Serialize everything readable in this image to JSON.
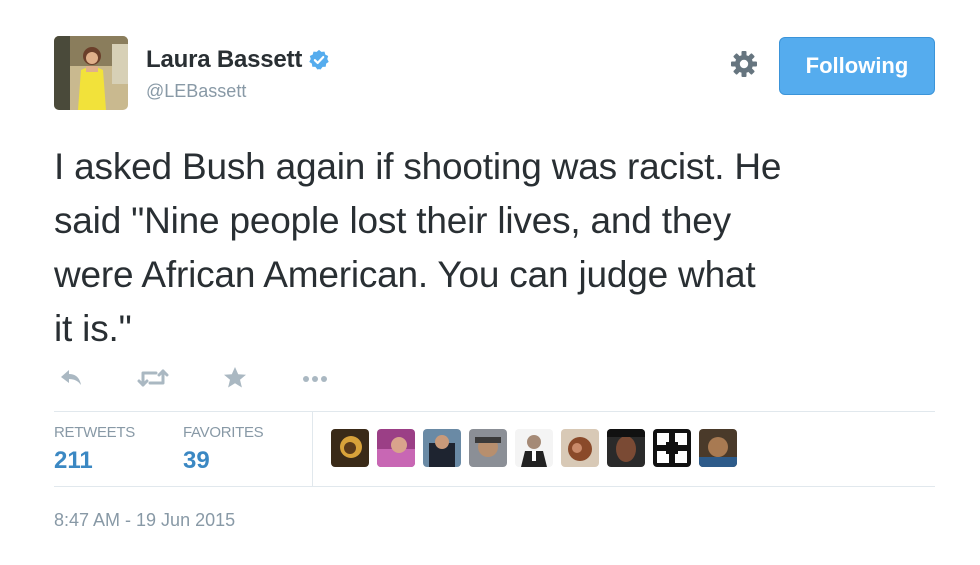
{
  "user": {
    "name": "Laura Bassett",
    "handle": "@LEBassett",
    "avatar_icon": "profile-photo"
  },
  "header": {
    "follow_label": "Following",
    "settings_icon": "gear-icon"
  },
  "tweet": {
    "lines": [
      "I asked Bush again if shooting was racist. He",
      "said \"Nine people lost their lives, and they",
      "were African American. You can judge what",
      "it is.\""
    ],
    "timestamp": "8:47 AM - 19 Jun 2015"
  },
  "actions": [
    "reply-icon",
    "retweet-icon",
    "favorite-icon",
    "more-icon"
  ],
  "stats": {
    "retweets_label": "RETWEETS",
    "retweets_value": "211",
    "favorites_label": "FAVORITES",
    "favorites_value": "39"
  },
  "colors": {
    "accent": "#55acee",
    "link": "#3b88c3",
    "muted": "#8899a6",
    "text": "#292f33",
    "divider": "#e1e8ed"
  }
}
